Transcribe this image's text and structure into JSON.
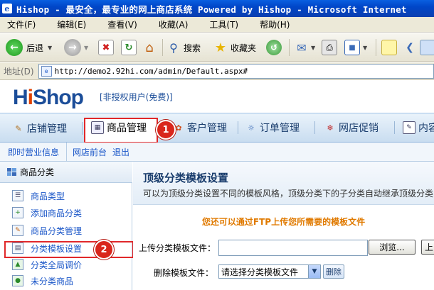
{
  "window": {
    "title": "Hishop - 最安全，最专业的网上商店系统 Powered by Hishop - Microsoft Internet"
  },
  "menu": [
    "文件(F)",
    "编辑(E)",
    "查看(V)",
    "收藏(A)",
    "工具(T)",
    "帮助(H)"
  ],
  "toolbar": {
    "back_label": "后退",
    "search_label": "搜索",
    "favorites_label": "收藏夹"
  },
  "address": {
    "label": "地址(D)",
    "url": "http://demo2.92hi.com/admin/Default.aspx#"
  },
  "header": {
    "logo_prefix": "H",
    "logo_i": "i",
    "logo_suffix": "Shop",
    "user_status": "[非授权用户(免费)]"
  },
  "main_nav": [
    {
      "label": "店铺管理"
    },
    {
      "label": "商品管理"
    },
    {
      "label": "客户管理"
    },
    {
      "label": "订单管理"
    },
    {
      "label": "网店促销"
    },
    {
      "label": "内容"
    }
  ],
  "badges": {
    "one": "1",
    "two": "2"
  },
  "sub_nav": {
    "business_info": "即时营业信息",
    "store_front": "网店前台",
    "logout": "退出"
  },
  "sidebar": {
    "heading": "商品分类",
    "items": [
      {
        "label": "商品类型"
      },
      {
        "label": "添加商品分类"
      },
      {
        "label": "商品分类管理"
      },
      {
        "label": "分类模板设置"
      },
      {
        "label": "分类全局调价"
      },
      {
        "label": "未分类商品"
      }
    ]
  },
  "content": {
    "title": "顶级分类模板设置",
    "description": "可以为顶级分类设置不同的模板风格，顶级分类下的子分类自动继承顶级分类",
    "ftp_notice": "您还可以通过FTP上传您所需要的模板文件",
    "upload_label": "上传分类模板文件：",
    "browse_label": "浏览...",
    "upload_button": "上",
    "delete_label": "删除模板文件：",
    "select_value": "请选择分类模板文件",
    "delete_button": "删除"
  },
  "colors": {
    "titlebar": "#0046c8",
    "highlight_red": "#e0282a",
    "link_blue": "#1a56c8",
    "notice_orange": "#e07a00"
  }
}
